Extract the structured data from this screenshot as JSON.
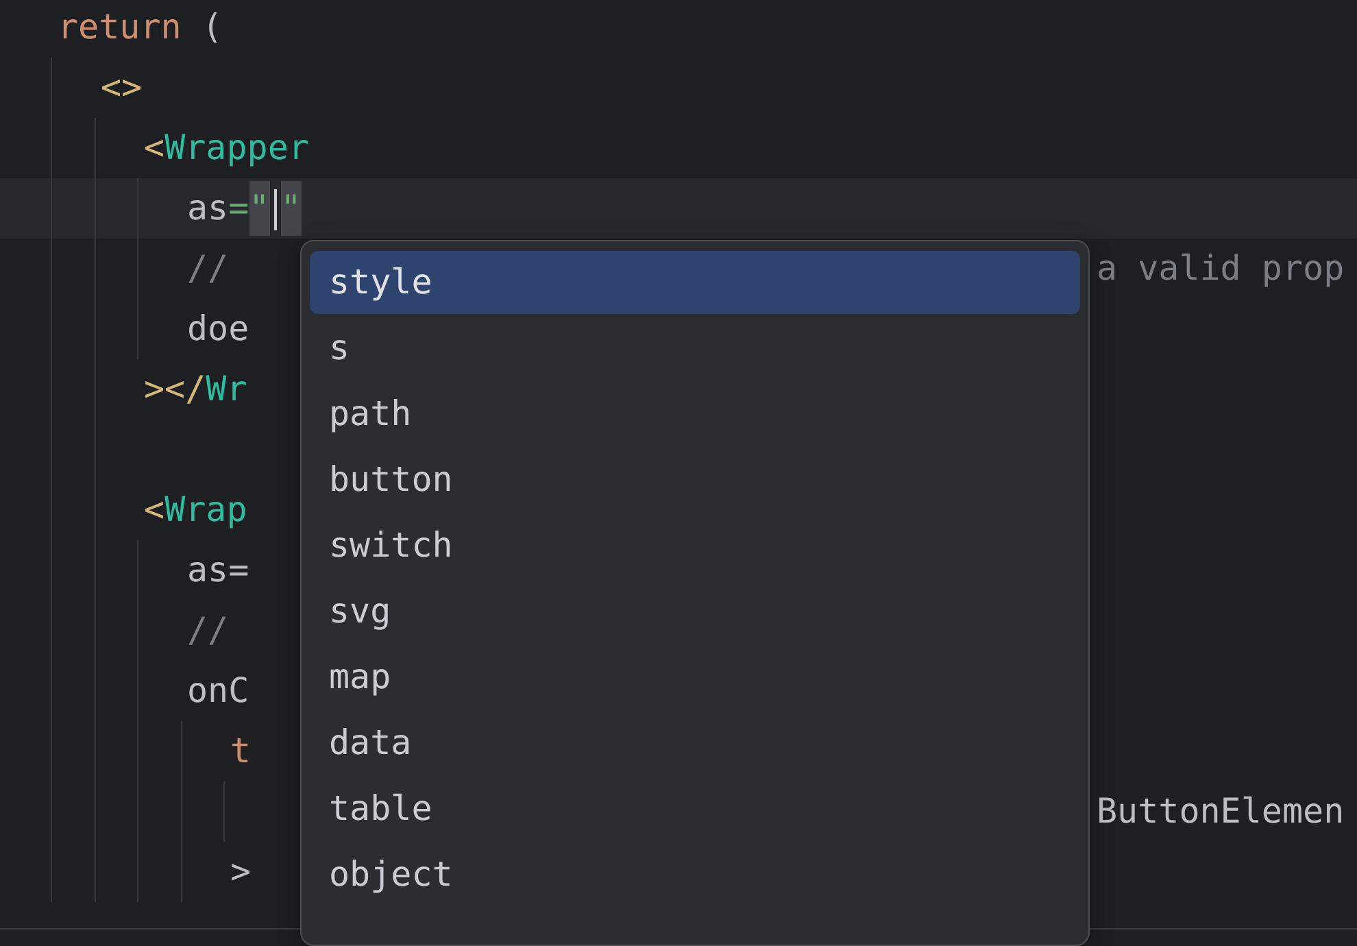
{
  "editor": {
    "lines": [
      {
        "kind": "code",
        "tokens": [
          {
            "text": "return",
            "kind": "keyword"
          },
          {
            "text": " (",
            "kind": "plain"
          }
        ],
        "children": [
          {
            "kind": "code",
            "tokens": [
              {
                "text": "<>",
                "kind": "bracket"
              }
            ],
            "children": [
              {
                "kind": "code",
                "tokens": [
                  {
                    "text": "<",
                    "kind": "bracket"
                  },
                  {
                    "text": "Wrapper",
                    "kind": "component"
                  }
                ],
                "children": [
                  {
                    "kind": "code",
                    "current": true,
                    "tokens": [
                      {
                        "text": "as",
                        "kind": "plain"
                      },
                      {
                        "text": "=",
                        "kind": "string"
                      },
                      {
                        "text": "\"",
                        "kind": "string",
                        "matched": true
                      },
                      {
                        "kind": "caret"
                      },
                      {
                        "text": "\"",
                        "kind": "string",
                        "matched": true
                      }
                    ]
                  },
                  {
                    "kind": "code",
                    "tokens": [
                      {
                        "text": "//",
                        "kind": "comment"
                      }
                    ],
                    "tail": {
                      "text": "a valid prop",
                      "kind": "comment"
                    }
                  },
                  {
                    "kind": "code",
                    "tokens": [
                      {
                        "text": "doe",
                        "kind": "plain"
                      }
                    ]
                  }
                ]
              },
              {
                "kind": "code",
                "tokens": [
                  {
                    "text": "></",
                    "kind": "bracket"
                  },
                  {
                    "text": "Wr",
                    "kind": "component"
                  }
                ]
              },
              {
                "kind": "blank"
              },
              {
                "kind": "code",
                "tokens": [
                  {
                    "text": "<",
                    "kind": "bracket"
                  },
                  {
                    "text": "Wrap",
                    "kind": "component"
                  }
                ],
                "children": [
                  {
                    "kind": "code",
                    "tokens": [
                      {
                        "text": "as=",
                        "kind": "plain"
                      }
                    ]
                  },
                  {
                    "kind": "code",
                    "tokens": [
                      {
                        "text": "//",
                        "kind": "comment"
                      }
                    ]
                  },
                  {
                    "kind": "code",
                    "tokens": [
                      {
                        "text": "onC",
                        "kind": "plain"
                      }
                    ],
                    "children": [
                      {
                        "kind": "code",
                        "tokens": [
                          {
                            "text": "t",
                            "kind": "keyword"
                          }
                        ],
                        "children": [
                          {
                            "kind": "blank",
                            "tail": {
                              "text": "ButtonElemen",
                              "kind": "plain"
                            }
                          }
                        ]
                      },
                      {
                        "kind": "code",
                        "tokens": [
                          {
                            "text": ">",
                            "kind": "plain"
                          }
                        ]
                      }
                    ]
                  }
                ]
              }
            ]
          }
        ]
      }
    ]
  },
  "completion": {
    "items": [
      {
        "label": "style",
        "selected": true
      },
      {
        "label": "s",
        "selected": false
      },
      {
        "label": "path",
        "selected": false
      },
      {
        "label": "button",
        "selected": false
      },
      {
        "label": "switch",
        "selected": false
      },
      {
        "label": "svg",
        "selected": false
      },
      {
        "label": "map",
        "selected": false
      },
      {
        "label": "data",
        "selected": false
      },
      {
        "label": "table",
        "selected": false
      },
      {
        "label": "object",
        "selected": false
      }
    ]
  }
}
